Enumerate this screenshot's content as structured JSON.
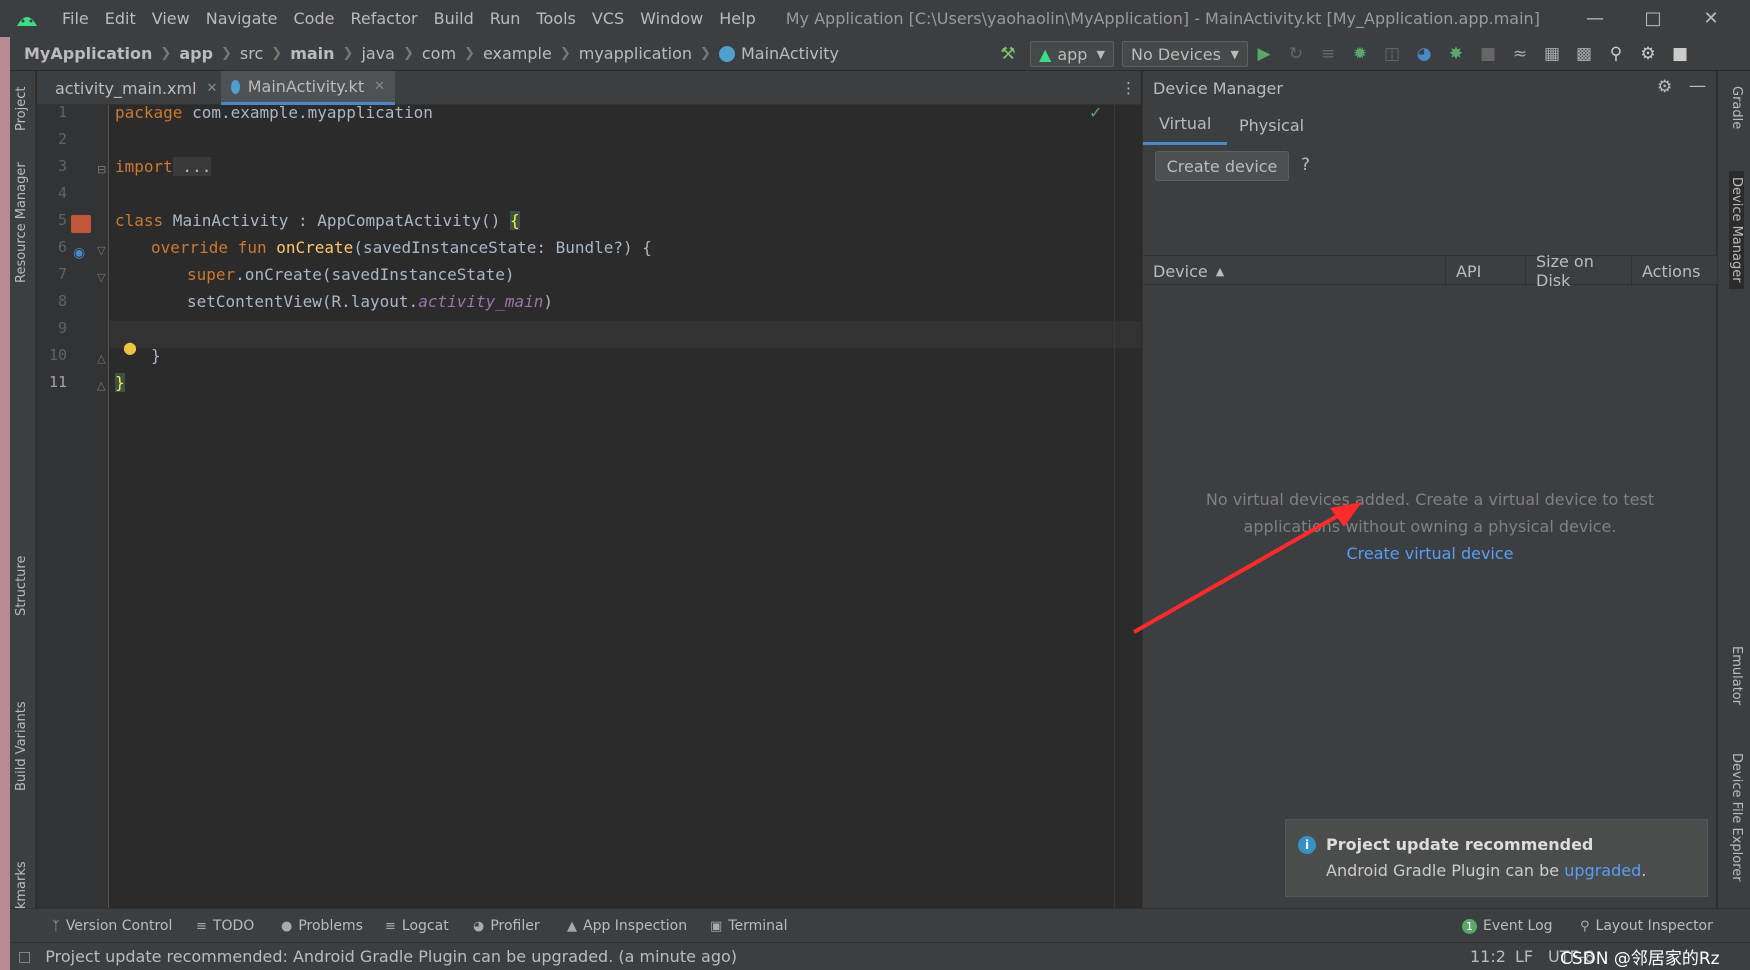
{
  "menubar": {
    "items": [
      "File",
      "Edit",
      "View",
      "Navigate",
      "Code",
      "Refactor",
      "Build",
      "Run",
      "Tools",
      "VCS",
      "Window",
      "Help"
    ],
    "title": "My Application [C:\\Users\\yaohaolin\\MyApplication] - MainActivity.kt [My_Application.app.main]"
  },
  "breadcrumb": [
    "MyApplication",
    "app",
    "src",
    "main",
    "java",
    "com",
    "example",
    "myapplication",
    "MainActivity"
  ],
  "toolbar": {
    "run_config": "app",
    "device": "No Devices"
  },
  "left_tools": [
    "Project",
    "Resource Manager",
    "Structure",
    "Build Variants",
    "Bookmarks"
  ],
  "right_tools": [
    "Gradle",
    "Device Manager",
    "Emulator",
    "Device File Explorer"
  ],
  "tabs": [
    {
      "label": "activity_main.xml"
    },
    {
      "label": "MainActivity.kt"
    }
  ],
  "editor": {
    "line_numbers": [
      "1",
      "2",
      "3",
      "4",
      "5",
      "6",
      "7",
      "8",
      "9",
      "10",
      "11"
    ],
    "code": {
      "l1_kw": "package",
      "l1_rest": " com.example.myapplication",
      "l3_kw": "import",
      "l3_rest": " ...",
      "l6_kw": "class",
      "l6_rest": " MainActivity : AppCompatActivity() ",
      "l6_brace": "{",
      "l7_kw1": "override",
      "l7_kw2": "fun",
      "l7_fn": "onCreate",
      "l7_rest": "(savedInstanceState: Bundle?) {",
      "l8_kw": "super",
      "l8_rest": ".onCreate(savedInstanceState)",
      "l9_pre": "setContentView(R.layout.",
      "l9_ital": "activity_main",
      "l9_post": ")",
      "l10": "}",
      "l11": "}"
    }
  },
  "device_manager": {
    "title": "Device Manager",
    "tabs": [
      "Virtual",
      "Physical"
    ],
    "create_button": "Create device",
    "help": "?",
    "columns": [
      "Device",
      "API",
      "Size on Disk",
      "Actions"
    ],
    "empty_line1": "No virtual devices added. Create a virtual device to test",
    "empty_line2": "applications without owning a physical device.",
    "empty_link": "Create virtual device"
  },
  "notification": {
    "title": "Project update recommended",
    "message_prefix": "Android Gradle Plugin can be ",
    "message_link": "upgraded",
    "message_suffix": "."
  },
  "bottom_tools": [
    "Version Control",
    "TODO",
    "Problems",
    "Logcat",
    "Profiler",
    "App Inspection",
    "Terminal"
  ],
  "bottom_right_tools": [
    "Event Log",
    "Layout Inspector"
  ],
  "event_log_badge": "1",
  "status": {
    "message": "Project update recommended: Android Gradle Plugin can be upgraded. (a minute ago)",
    "position": "11:2",
    "line_sep": "LF",
    "encoding": "UTF-8",
    "watermark": "CSDN @邻居家的Rz"
  },
  "colors": {
    "accent": "#4a88c7",
    "link": "#589df6",
    "keyword": "#cc7832",
    "function": "#ffc66d",
    "annotation_arrow": "#ff2b2b"
  }
}
